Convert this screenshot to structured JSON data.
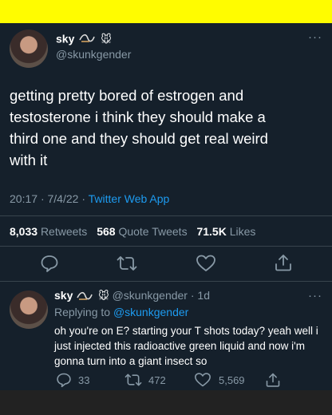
{
  "main_tweet": {
    "display_name": "sky",
    "name_emoji": "🐭",
    "handle": "@skunkgender",
    "text_lines": [
      "getting pretty bored of estrogen and",
      "testosterone i think they should make a",
      "third one and they should get real weird",
      "with it"
    ],
    "time": "20:17",
    "date": "7/4/22",
    "source": "Twitter Web App",
    "separator": "·",
    "stats": {
      "retweets_count": "8,033",
      "retweets_label": "Retweets",
      "quotes_count": "568",
      "quotes_label": "Quote Tweets",
      "likes_count": "71.5K",
      "likes_label": "Likes"
    }
  },
  "reply": {
    "display_name": "sky",
    "name_emoji": "🐭",
    "handle": "@skunkgender",
    "age": "· 1d",
    "replying_prefix": "Replying to",
    "replying_to": "@skunkgender",
    "text_lines": [
      "oh you're on E? starting your T shots today? yeah well i",
      "just injected this radioactive green liquid and now i'm",
      "gonna turn into a giant insect so"
    ],
    "replies": "33",
    "retweets": "472",
    "likes": "5,569"
  },
  "more_glyph": "···",
  "colors": {
    "background": "#15202b",
    "accent": "#1d9bf0",
    "muted": "#8899a6",
    "top_bar": "#fffc00"
  }
}
